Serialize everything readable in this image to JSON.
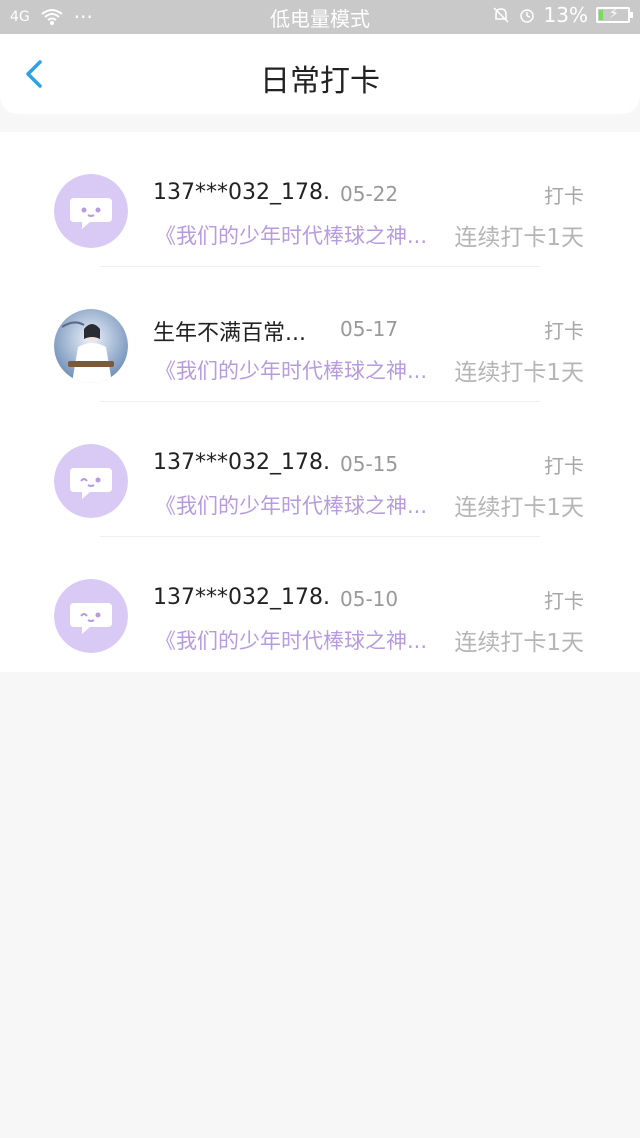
{
  "status_bar": {
    "signal": "4G",
    "mode": "低电量模式",
    "battery": "13%"
  },
  "header": {
    "title": "日常打卡"
  },
  "items": [
    {
      "name": "137***032_178...",
      "date": "05-22",
      "label": "打卡",
      "book": "《我们的少年时代棒球之神...",
      "streak": "连续打卡1天",
      "avatar": "chat-bubble-icon"
    },
    {
      "name": "生年不满百常...",
      "date": "05-17",
      "label": "打卡",
      "book": "《我们的少年时代棒球之神...",
      "streak": "连续打卡1天",
      "avatar": "user-photo"
    },
    {
      "name": "137***032_178...",
      "date": "05-15",
      "label": "打卡",
      "book": "《我们的少年时代棒球之神...",
      "streak": "连续打卡1天",
      "avatar": "chat-bubble-icon"
    },
    {
      "name": "137***032_178...",
      "date": "05-10",
      "label": "打卡",
      "book": "《我们的少年时代棒球之神...",
      "streak": "连续打卡1天",
      "avatar": "chat-bubble-icon"
    }
  ],
  "colors": {
    "accent": "#2f9fe8",
    "purple": "#b79be0",
    "avatar_bg": "#d9c9f5"
  }
}
